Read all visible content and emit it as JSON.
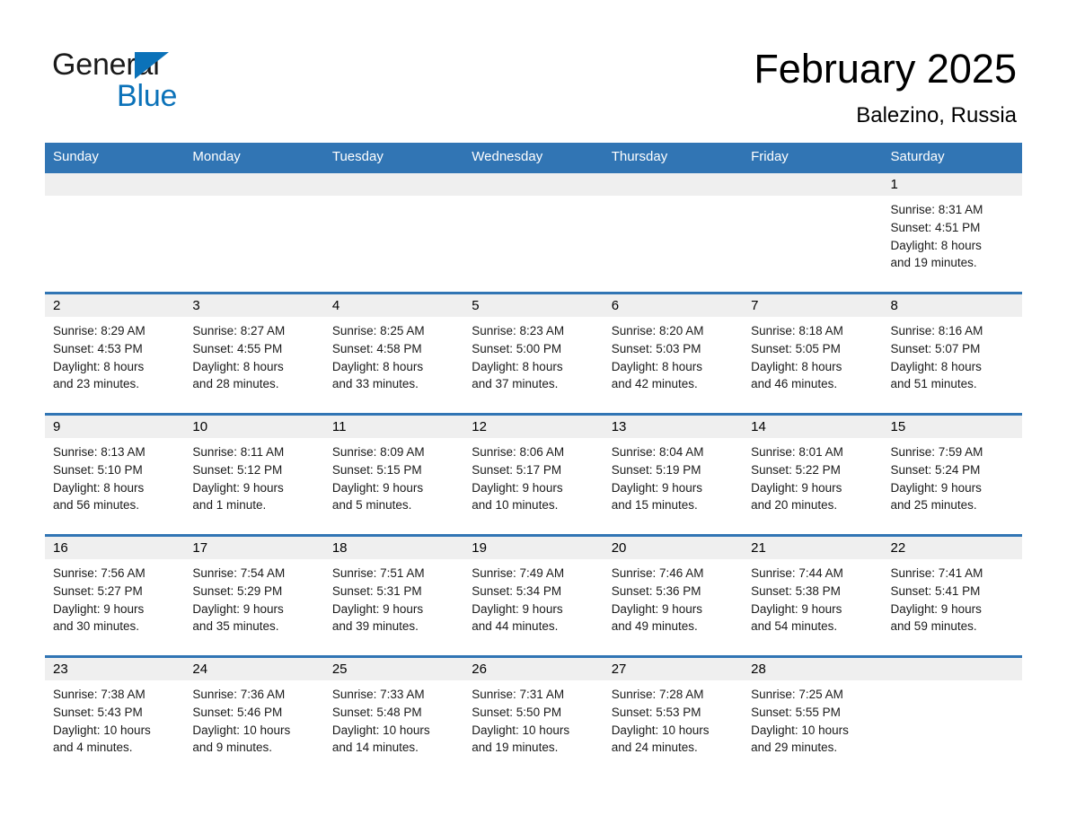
{
  "brand": {
    "name_part1": "General",
    "name_part2": "Blue",
    "accent_color": "#0b72b9"
  },
  "header": {
    "title": "February 2025",
    "subtitle": "Balezino, Russia"
  },
  "theme": {
    "header_blue": "#3175b4",
    "daynum_band": "#efefef",
    "cell_background": "#ffffff"
  },
  "calendar": {
    "weekday_headers": [
      "Sunday",
      "Monday",
      "Tuesday",
      "Wednesday",
      "Thursday",
      "Friday",
      "Saturday"
    ],
    "weeks": [
      [
        {
          "day": "",
          "lines": []
        },
        {
          "day": "",
          "lines": []
        },
        {
          "day": "",
          "lines": []
        },
        {
          "day": "",
          "lines": []
        },
        {
          "day": "",
          "lines": []
        },
        {
          "day": "",
          "lines": []
        },
        {
          "day": "1",
          "lines": [
            "Sunrise: 8:31 AM",
            "Sunset: 4:51 PM",
            "Daylight: 8 hours",
            "and 19 minutes."
          ]
        }
      ],
      [
        {
          "day": "2",
          "lines": [
            "Sunrise: 8:29 AM",
            "Sunset: 4:53 PM",
            "Daylight: 8 hours",
            "and 23 minutes."
          ]
        },
        {
          "day": "3",
          "lines": [
            "Sunrise: 8:27 AM",
            "Sunset: 4:55 PM",
            "Daylight: 8 hours",
            "and 28 minutes."
          ]
        },
        {
          "day": "4",
          "lines": [
            "Sunrise: 8:25 AM",
            "Sunset: 4:58 PM",
            "Daylight: 8 hours",
            "and 33 minutes."
          ]
        },
        {
          "day": "5",
          "lines": [
            "Sunrise: 8:23 AM",
            "Sunset: 5:00 PM",
            "Daylight: 8 hours",
            "and 37 minutes."
          ]
        },
        {
          "day": "6",
          "lines": [
            "Sunrise: 8:20 AM",
            "Sunset: 5:03 PM",
            "Daylight: 8 hours",
            "and 42 minutes."
          ]
        },
        {
          "day": "7",
          "lines": [
            "Sunrise: 8:18 AM",
            "Sunset: 5:05 PM",
            "Daylight: 8 hours",
            "and 46 minutes."
          ]
        },
        {
          "day": "8",
          "lines": [
            "Sunrise: 8:16 AM",
            "Sunset: 5:07 PM",
            "Daylight: 8 hours",
            "and 51 minutes."
          ]
        }
      ],
      [
        {
          "day": "9",
          "lines": [
            "Sunrise: 8:13 AM",
            "Sunset: 5:10 PM",
            "Daylight: 8 hours",
            "and 56 minutes."
          ]
        },
        {
          "day": "10",
          "lines": [
            "Sunrise: 8:11 AM",
            "Sunset: 5:12 PM",
            "Daylight: 9 hours",
            "and 1 minute."
          ]
        },
        {
          "day": "11",
          "lines": [
            "Sunrise: 8:09 AM",
            "Sunset: 5:15 PM",
            "Daylight: 9 hours",
            "and 5 minutes."
          ]
        },
        {
          "day": "12",
          "lines": [
            "Sunrise: 8:06 AM",
            "Sunset: 5:17 PM",
            "Daylight: 9 hours",
            "and 10 minutes."
          ]
        },
        {
          "day": "13",
          "lines": [
            "Sunrise: 8:04 AM",
            "Sunset: 5:19 PM",
            "Daylight: 9 hours",
            "and 15 minutes."
          ]
        },
        {
          "day": "14",
          "lines": [
            "Sunrise: 8:01 AM",
            "Sunset: 5:22 PM",
            "Daylight: 9 hours",
            "and 20 minutes."
          ]
        },
        {
          "day": "15",
          "lines": [
            "Sunrise: 7:59 AM",
            "Sunset: 5:24 PM",
            "Daylight: 9 hours",
            "and 25 minutes."
          ]
        }
      ],
      [
        {
          "day": "16",
          "lines": [
            "Sunrise: 7:56 AM",
            "Sunset: 5:27 PM",
            "Daylight: 9 hours",
            "and 30 minutes."
          ]
        },
        {
          "day": "17",
          "lines": [
            "Sunrise: 7:54 AM",
            "Sunset: 5:29 PM",
            "Daylight: 9 hours",
            "and 35 minutes."
          ]
        },
        {
          "day": "18",
          "lines": [
            "Sunrise: 7:51 AM",
            "Sunset: 5:31 PM",
            "Daylight: 9 hours",
            "and 39 minutes."
          ]
        },
        {
          "day": "19",
          "lines": [
            "Sunrise: 7:49 AM",
            "Sunset: 5:34 PM",
            "Daylight: 9 hours",
            "and 44 minutes."
          ]
        },
        {
          "day": "20",
          "lines": [
            "Sunrise: 7:46 AM",
            "Sunset: 5:36 PM",
            "Daylight: 9 hours",
            "and 49 minutes."
          ]
        },
        {
          "day": "21",
          "lines": [
            "Sunrise: 7:44 AM",
            "Sunset: 5:38 PM",
            "Daylight: 9 hours",
            "and 54 minutes."
          ]
        },
        {
          "day": "22",
          "lines": [
            "Sunrise: 7:41 AM",
            "Sunset: 5:41 PM",
            "Daylight: 9 hours",
            "and 59 minutes."
          ]
        }
      ],
      [
        {
          "day": "23",
          "lines": [
            "Sunrise: 7:38 AM",
            "Sunset: 5:43 PM",
            "Daylight: 10 hours",
            "and 4 minutes."
          ]
        },
        {
          "day": "24",
          "lines": [
            "Sunrise: 7:36 AM",
            "Sunset: 5:46 PM",
            "Daylight: 10 hours",
            "and 9 minutes."
          ]
        },
        {
          "day": "25",
          "lines": [
            "Sunrise: 7:33 AM",
            "Sunset: 5:48 PM",
            "Daylight: 10 hours",
            "and 14 minutes."
          ]
        },
        {
          "day": "26",
          "lines": [
            "Sunrise: 7:31 AM",
            "Sunset: 5:50 PM",
            "Daylight: 10 hours",
            "and 19 minutes."
          ]
        },
        {
          "day": "27",
          "lines": [
            "Sunrise: 7:28 AM",
            "Sunset: 5:53 PM",
            "Daylight: 10 hours",
            "and 24 minutes."
          ]
        },
        {
          "day": "28",
          "lines": [
            "Sunrise: 7:25 AM",
            "Sunset: 5:55 PM",
            "Daylight: 10 hours",
            "and 29 minutes."
          ]
        },
        {
          "day": "",
          "lines": []
        }
      ]
    ]
  }
}
